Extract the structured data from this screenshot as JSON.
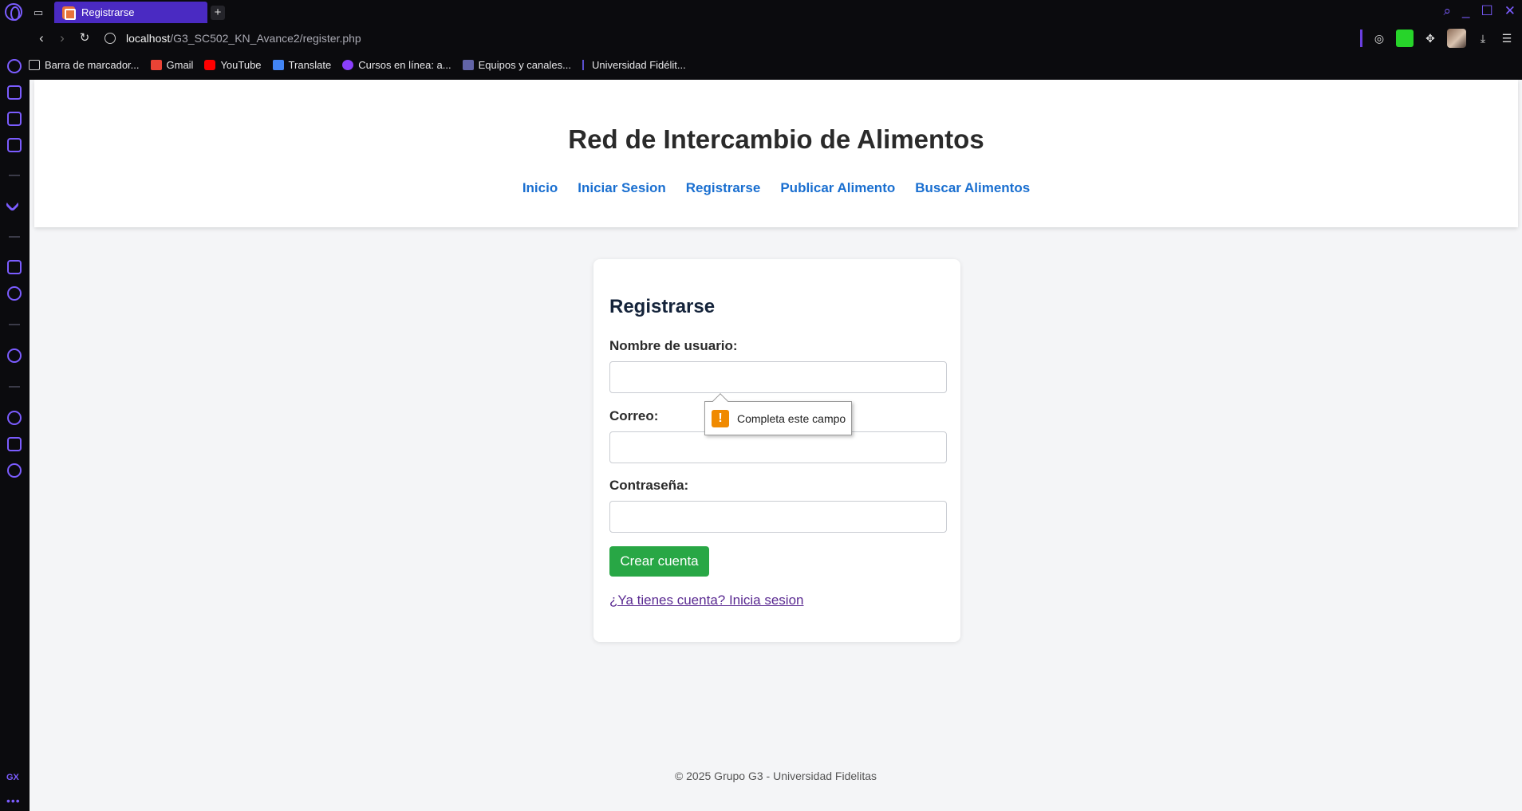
{
  "browser": {
    "tab_title": "Registrarse",
    "url_host": "localhost",
    "url_path": "/G3_SC502_KN_Avance2/register.php",
    "accent_color": "#7b5cff"
  },
  "bookmarks": [
    {
      "label": "Barra de marcador...",
      "icon": "folder-icon",
      "color": "#cfcfcf"
    },
    {
      "label": "Gmail",
      "icon": "gmail-icon",
      "color": "#ea4335"
    },
    {
      "label": "YouTube",
      "icon": "youtube-icon",
      "color": "#ff0000"
    },
    {
      "label": "Translate",
      "icon": "translate-icon",
      "color": "#4285f4"
    },
    {
      "label": "Cursos en línea: a...",
      "icon": "courses-icon",
      "color": "#8a3ffc"
    },
    {
      "label": "Equipos y canales...",
      "icon": "teams-icon",
      "color": "#6264a7"
    },
    {
      "label": "Universidad Fidélit...",
      "icon": "university-icon",
      "color": "#5a4fd0"
    }
  ],
  "site": {
    "title": "Red de Intercambio de Alimentos",
    "nav": [
      "Inicio",
      "Iniciar Sesion",
      "Registrarse",
      "Publicar Alimento",
      "Buscar Alimentos"
    ]
  },
  "form": {
    "heading": "Registrarse",
    "username_label": "Nombre de usuario:",
    "username_value": "",
    "email_label": "Correo:",
    "email_value": "",
    "password_label": "Contraseña:",
    "password_value": "",
    "submit_label": "Crear cuenta",
    "login_link": "¿Ya tienes cuenta? Inicia sesion",
    "submit_color": "#28a745"
  },
  "validation_tooltip": {
    "message": "Completa este campo",
    "icon": "warning-icon"
  },
  "footer": {
    "text": "© 2025 Grupo G3 - Universidad Fidelitas"
  }
}
